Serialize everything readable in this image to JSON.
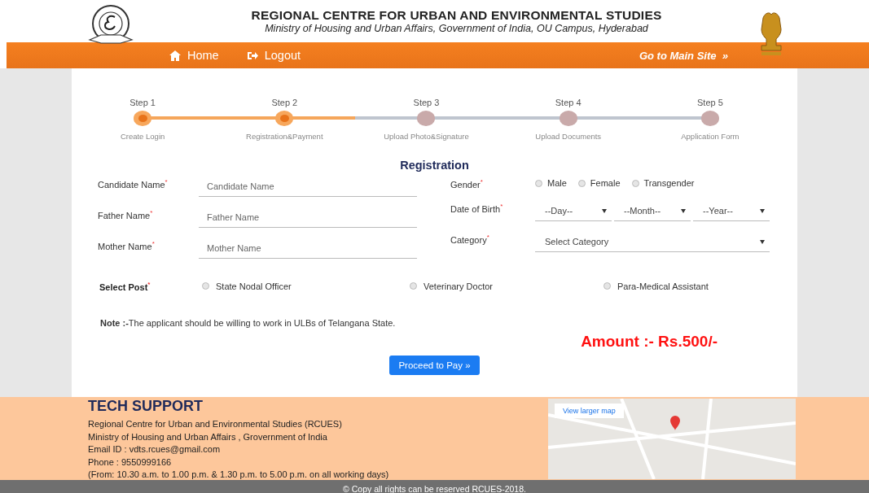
{
  "header": {
    "title": "REGIONAL CENTRE FOR URBAN AND ENVIRONMENTAL STUDIES",
    "subtitle": "Ministry of Housing and Urban Affairs, Government of India, OU Campus, Hyderabad"
  },
  "nav": {
    "items": [
      {
        "label": "Home"
      },
      {
        "label": "Logout"
      }
    ],
    "main_site": {
      "label": "Go to Main Site",
      "arrow": "»"
    }
  },
  "steps": [
    {
      "label": "Step 1",
      "caption": "Create Login",
      "done": true
    },
    {
      "label": "Step 2",
      "caption": "Registration&Payment",
      "done": true
    },
    {
      "label": "Step 3",
      "caption": "Upload Photo&Signature",
      "done": false
    },
    {
      "label": "Step 4",
      "caption": "Upload Documents",
      "done": false
    },
    {
      "label": "Step 5",
      "caption": "Application Form",
      "done": false
    }
  ],
  "form_title": "Registration",
  "left_fields": [
    {
      "label": "Candidate Name$^{*}$",
      "placeholder": "Candidate Name"
    },
    {
      "label": "Father Name$^{*}$",
      "placeholder": "Father Name"
    },
    {
      "label": "Mother Name$^{*}$",
      "placeholder": "Mother Name"
    }
  ],
  "gender": {
    "label": "Gender$^{*}$",
    "options": [
      {
        "label": "Male",
        "selected": false
      },
      {
        "label": "Female",
        "selected": false
      },
      {
        "label": "Transgender",
        "selected": false
      }
    ]
  },
  "dob": {
    "label": "Date of Birth$^{*}$",
    "selects": [
      "--Day--",
      "--Month--",
      "--Year--"
    ]
  },
  "category": {
    "label": "Category$^{*}$",
    "value": "Select Category"
  },
  "post": {
    "label": "Select Post$^{*}$",
    "options": [
      {
        "label": "State Nodal Officer",
        "selected": false
      },
      {
        "label": "Veterinary Doctor",
        "selected": false
      },
      {
        "label": "Para-Medical Assistant",
        "selected": false
      }
    ]
  },
  "note": "**Note :-**The applicant should be willing to work in ULBs of Telangana State.",
  "amount": "Amount :- Rs.500/-",
  "proceed": {
    "label": "Proceed to Pay",
    "arrow": "»"
  },
  "support": {
    "title": "TECH SUPPORT",
    "lines": [
      "Regional Centre for Urban and Environmental Studies (RCUES)",
      "Ministry of Housing and Urban Affairs , Grovernment of India",
      "Email ID : vdts.rcues@gmail.com",
      "Phone : 9550999166",
      "(From: 10.30 a.m. to 1.00 p.m. & 1.30 p.m. to 5.00 p.m. on all working days)"
    ]
  },
  "map": {
    "link": "View larger map"
  },
  "copyright": "© Copy all rights can be reserved RCUES-2018."
}
